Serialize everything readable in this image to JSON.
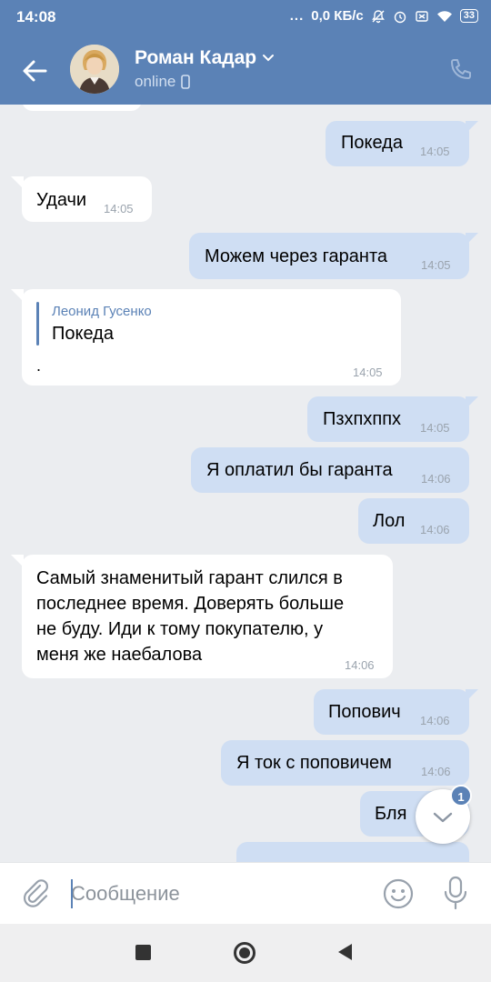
{
  "status_bar": {
    "time": "14:08",
    "dots": "...",
    "net_speed": "0,0 КБ/с",
    "battery": "33"
  },
  "header": {
    "contact_name": "Роман Кадар",
    "presence": "online"
  },
  "messages": [
    {
      "dir": "out",
      "text": "Покеда",
      "time": "14:05"
    },
    {
      "dir": "in",
      "text": "Удачи",
      "time": "14:05"
    },
    {
      "dir": "out",
      "text": "Можем через гаранта",
      "time": "14:05"
    },
    {
      "dir": "in",
      "reply_author": "Леонид Гусенко",
      "reply_text": "Покеда",
      "text": ".",
      "time": "14:05"
    },
    {
      "dir": "out",
      "text": "Пзхпхппх",
      "time": "14:05"
    },
    {
      "dir": "out",
      "text": "Я оплатил бы гаранта",
      "time": "14:06"
    },
    {
      "dir": "out",
      "text": "Лол",
      "time": "14:06"
    },
    {
      "dir": "in",
      "lines": [
        "Самый знаменитый гарант слился в",
        "последнее время. Доверять больше",
        "не буду. Иди к тому покупателю, у",
        "меня же наебалова"
      ],
      "time": "14:06"
    },
    {
      "dir": "out",
      "text": "Попович",
      "time": "14:06"
    },
    {
      "dir": "out",
      "text": "Я ток с поповичем",
      "time": "14:06"
    },
    {
      "dir": "out",
      "text": "Бля",
      "time": ""
    }
  ],
  "scroll_button": {
    "unread_count": "1"
  },
  "composer": {
    "placeholder": "Сообщение"
  },
  "colors": {
    "accent": "#5b82b6",
    "outgoing_bubble": "#cfdef3",
    "incoming_bubble": "#ffffff",
    "background": "#ebedf0"
  }
}
